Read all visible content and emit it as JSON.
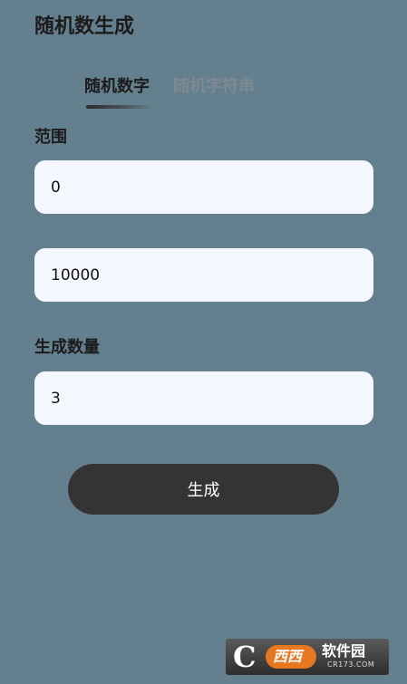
{
  "header": {
    "title": "随机数生成"
  },
  "tabs": [
    {
      "label": "随机数字",
      "active": true
    },
    {
      "label": "随机字符串",
      "active": false
    }
  ],
  "range": {
    "label": "范围",
    "min_value": "0",
    "max_value": "10000"
  },
  "count": {
    "label": "生成数量",
    "value": "3"
  },
  "actions": {
    "generate_label": "生成"
  },
  "watermark": {
    "letter": "C",
    "badge": "西西",
    "name": "软件园",
    "domain": "CR173.COM"
  },
  "colors": {
    "background": "#647f8d",
    "field_background": "#f4f8fe",
    "button_background": "#343434",
    "active_tab": "#1c1c1c",
    "inactive_tab": "#7d8a92"
  }
}
